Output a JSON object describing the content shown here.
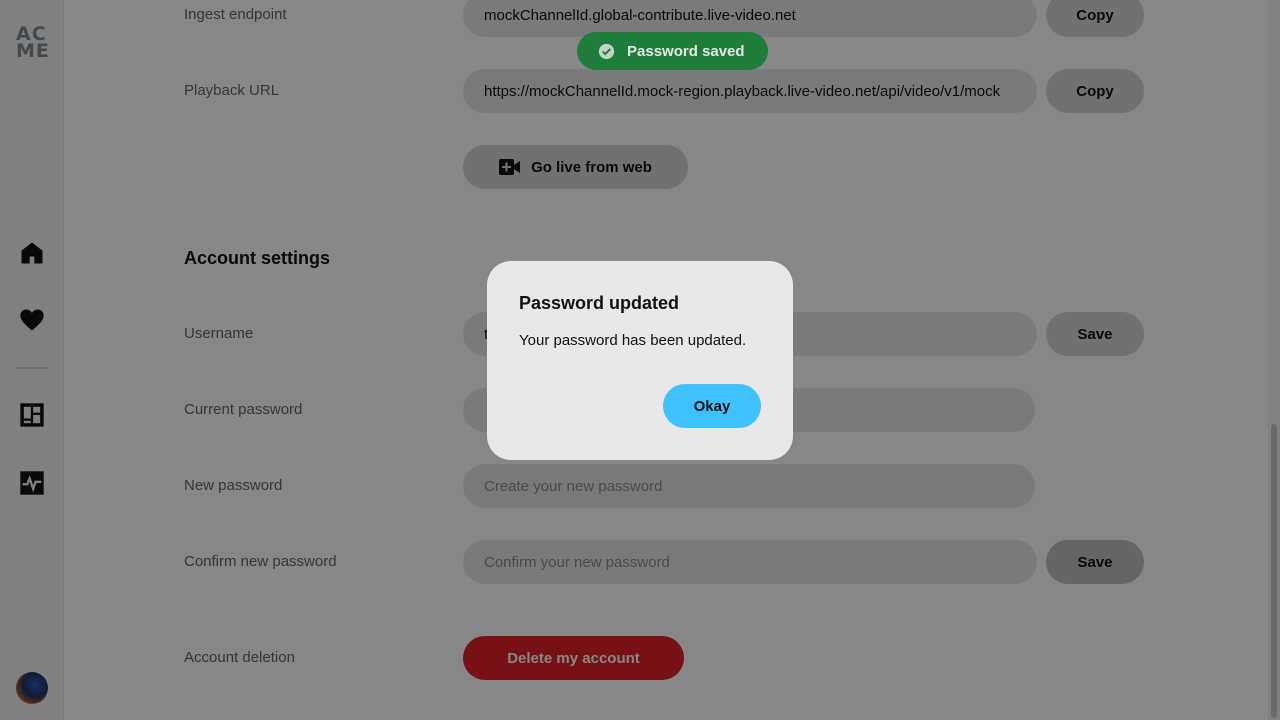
{
  "sidebar": {
    "logo_line1": "AC",
    "logo_line2": "ME",
    "items": [
      {
        "icon": "home-icon"
      },
      {
        "icon": "heart-icon"
      },
      {
        "icon": "dashboard-icon"
      },
      {
        "icon": "activity-icon"
      }
    ],
    "avatar": "user-avatar"
  },
  "stream": {
    "ingest_label": "Ingest endpoint",
    "ingest_value": "mockChannelId.global-contribute.live-video.net",
    "playback_label": "Playback URL",
    "playback_value": "https://mockChannelId.mock-region.playback.live-video.net/api/video/v1/mock",
    "copy_label": "Copy",
    "golive_label": "Go live from web"
  },
  "account": {
    "title": "Account settings",
    "username_label": "Username",
    "username_value": "t",
    "current_password_label": "Current password",
    "current_password_value": "",
    "new_password_label": "New password",
    "new_password_placeholder": "Create your new password",
    "confirm_password_label": "Confirm new password",
    "confirm_password_placeholder": "Confirm your new password",
    "save_label": "Save",
    "deletion_label": "Account deletion",
    "delete_button": "Delete my account"
  },
  "toast": {
    "text": "Password saved",
    "color": "#1e7d3a"
  },
  "modal": {
    "title": "Password updated",
    "message": "Your password has been updated.",
    "ok_label": "Okay",
    "ok_color": "#3ec1ff"
  }
}
